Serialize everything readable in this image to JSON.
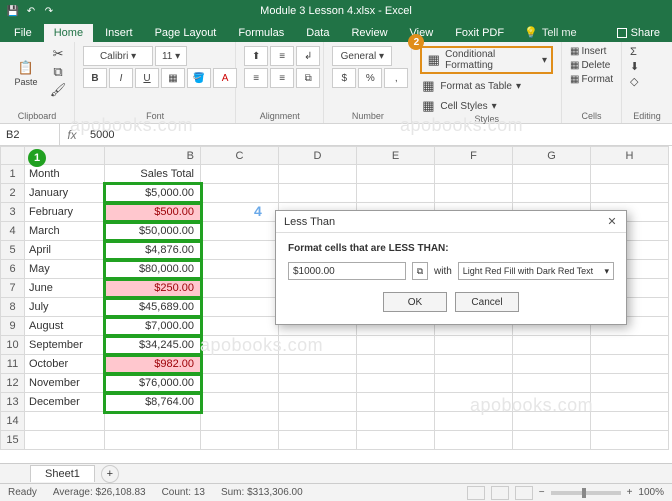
{
  "app": {
    "title": "Module 3 Lesson 4.xlsx - Excel"
  },
  "qat": {
    "save_icon": "💾",
    "undo_icon": "↶",
    "redo_icon": "↷"
  },
  "tabs": {
    "file": "File",
    "home": "Home",
    "insert": "Insert",
    "page_layout": "Page Layout",
    "formulas": "Formulas",
    "data": "Data",
    "review": "Review",
    "view": "View",
    "foxit": "Foxit PDF",
    "tellme": "Tell me",
    "share": "Share"
  },
  "ribbon": {
    "clipboard": {
      "label": "Clipboard",
      "paste": "Paste"
    },
    "font": {
      "label": "Font"
    },
    "alignment": {
      "label": "Alignment"
    },
    "number": {
      "label": "Number"
    },
    "styles": {
      "label": "Styles",
      "conditional": "Conditional Formatting",
      "format_table": "Format as Table",
      "cell_styles": "Cell Styles"
    },
    "cells": {
      "label": "Cells",
      "insert": "Insert",
      "delete": "Delete",
      "format": "Format"
    },
    "editing": {
      "label": "Editing",
      "autosum": "Σ",
      "fill": "⬇",
      "clear": "◇"
    }
  },
  "markers": {
    "m1": "1",
    "m2": "2",
    "m4": "4"
  },
  "cellref": {
    "name": "B2",
    "fx": "fx",
    "value": "5000"
  },
  "columns": [
    "A",
    "B",
    "C",
    "D",
    "E",
    "F",
    "G",
    "H"
  ],
  "rows": [
    {
      "n": "1",
      "a": "Month",
      "b": "Sales Total",
      "hl": false
    },
    {
      "n": "2",
      "a": "January",
      "b": "$5,000.00",
      "hl": false
    },
    {
      "n": "3",
      "a": "February",
      "b": "$500.00",
      "hl": true
    },
    {
      "n": "4",
      "a": "March",
      "b": "$50,000.00",
      "hl": false
    },
    {
      "n": "5",
      "a": "April",
      "b": "$4,876.00",
      "hl": false
    },
    {
      "n": "6",
      "a": "May",
      "b": "$80,000.00",
      "hl": false
    },
    {
      "n": "7",
      "a": "June",
      "b": "$250.00",
      "hl": true
    },
    {
      "n": "8",
      "a": "July",
      "b": "$45,689.00",
      "hl": false
    },
    {
      "n": "9",
      "a": "August",
      "b": "$7,000.00",
      "hl": false
    },
    {
      "n": "10",
      "a": "September",
      "b": "$34,245.00",
      "hl": false
    },
    {
      "n": "11",
      "a": "October",
      "b": "$982.00",
      "hl": true
    },
    {
      "n": "12",
      "a": "November",
      "b": "$76,000.00",
      "hl": false
    },
    {
      "n": "13",
      "a": "December",
      "b": "$8,764.00",
      "hl": false
    },
    {
      "n": "14",
      "a": "",
      "b": "",
      "hl": false
    },
    {
      "n": "15",
      "a": "",
      "b": "",
      "hl": false
    }
  ],
  "dialog": {
    "title": "Less Than",
    "prompt": "Format cells that are LESS THAN:",
    "value": "$1000.00",
    "with": "with",
    "format_option": "Light Red Fill with Dark Red Text",
    "ok": "OK",
    "cancel": "Cancel",
    "close": "✕",
    "dropdown": "▾",
    "refpick": "⧉"
  },
  "sheet_tabs": {
    "sheet1": "Sheet1",
    "add": "+"
  },
  "status": {
    "mode": "Ready",
    "average": "Average: $26,108.83",
    "count": "Count: 13",
    "sum": "Sum: $313,306.00",
    "zoom": "100%",
    "minus": "−",
    "plus": "+"
  },
  "watermark": "apobooks.com",
  "chart_data": {
    "type": "table",
    "title": "Sales Total by Month",
    "categories": [
      "January",
      "February",
      "March",
      "April",
      "May",
      "June",
      "July",
      "August",
      "September",
      "October",
      "November",
      "December"
    ],
    "values": [
      5000,
      500,
      50000,
      4876,
      80000,
      250,
      45689,
      7000,
      34245,
      982,
      76000,
      8764
    ],
    "xlabel": "Month",
    "ylabel": "Sales Total",
    "highlight_rule": "less_than_1000"
  }
}
